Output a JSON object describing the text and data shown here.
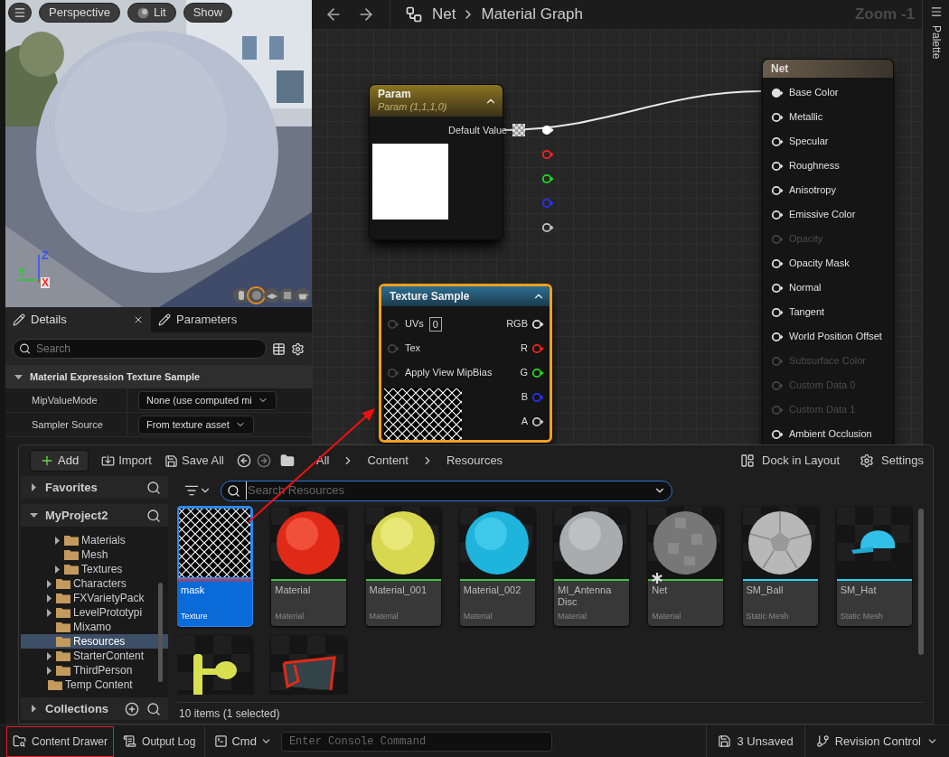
{
  "viewport": {
    "toolbar": [
      {
        "label": "Perspective",
        "icon": false
      },
      {
        "label": "Lit",
        "icon": true
      },
      {
        "label": "Show",
        "icon": false
      }
    ],
    "axes": [
      {
        "label": "Z",
        "color": "#3550ff"
      },
      {
        "label": "Y",
        "color": "#22d022"
      },
      {
        "label": "X",
        "color": "#ff2a2a"
      }
    ],
    "preview_shapes": [
      {
        "kind": "cylinder",
        "selected": false
      },
      {
        "kind": "sphere",
        "selected": true
      },
      {
        "kind": "plane",
        "selected": false
      },
      {
        "kind": "cube",
        "selected": false
      },
      {
        "kind": "teapot",
        "selected": false
      }
    ]
  },
  "details": {
    "tabs": [
      {
        "label": "Details",
        "selected": true,
        "closable": true
      },
      {
        "label": "Parameters",
        "selected": false,
        "closable": false
      }
    ],
    "search": {
      "placeholder": "Search"
    },
    "section": {
      "title": "Material Expression Texture Sample",
      "expanded": true
    },
    "properties": [
      {
        "name": "MipValueMode",
        "value": "None (use computed mi"
      },
      {
        "name": "Sampler Source",
        "value": "From texture asset"
      }
    ]
  },
  "graph": {
    "breadcrumb": [
      "Net",
      "Material Graph"
    ],
    "zoom": "Zoom -1",
    "palette": "Palette",
    "param_node": {
      "title": "Param",
      "subtitle": "Param (1,1,1,0)",
      "selected": false,
      "value_label": "Default Value",
      "outputs": [
        {
          "color": "#ffffff",
          "connected": true
        },
        {
          "color": "#ff2020",
          "connected": false
        },
        {
          "color": "#20e020",
          "connected": false
        },
        {
          "color": "#2a30ff",
          "connected": false
        },
        {
          "color": "#c8c8c8",
          "connected": false
        }
      ]
    },
    "texture_node": {
      "title": "Texture Sample",
      "selected": true,
      "inputs": [
        {
          "label": "UVs",
          "value": "0"
        },
        {
          "label": "Tex"
        },
        {
          "label": "Apply View MipBias"
        }
      ],
      "outputs": [
        {
          "label": "RGB",
          "color": "#e0e0e0"
        },
        {
          "label": "R",
          "color": "#ff2020"
        },
        {
          "label": "G",
          "color": "#20e020"
        },
        {
          "label": "B",
          "color": "#2a30ff"
        },
        {
          "label": "A",
          "color": "#c8c8c8"
        }
      ]
    },
    "output_node": {
      "title": "Net",
      "selected": false,
      "inputs": [
        {
          "label": "Base Color",
          "connected": true,
          "disabled": false
        },
        {
          "label": "Metallic",
          "connected": false,
          "disabled": false
        },
        {
          "label": "Specular",
          "connected": false,
          "disabled": false
        },
        {
          "label": "Roughness",
          "connected": false,
          "disabled": false
        },
        {
          "label": "Anisotropy",
          "connected": false,
          "disabled": false
        },
        {
          "label": "Emissive Color",
          "connected": false,
          "disabled": false
        },
        {
          "label": "Opacity",
          "connected": false,
          "disabled": true
        },
        {
          "label": "Opacity Mask",
          "connected": false,
          "disabled": false
        },
        {
          "label": "Normal",
          "connected": false,
          "disabled": false
        },
        {
          "label": "Tangent",
          "connected": false,
          "disabled": false
        },
        {
          "label": "World Position Offset",
          "connected": false,
          "disabled": false
        },
        {
          "label": "Subsurface Color",
          "connected": false,
          "disabled": true
        },
        {
          "label": "Custom Data 0",
          "connected": false,
          "disabled": true
        },
        {
          "label": "Custom Data 1",
          "connected": false,
          "disabled": true
        },
        {
          "label": "Ambient Occlusion",
          "connected": false,
          "disabled": false
        }
      ]
    }
  },
  "content_drawer": {
    "toolbar": {
      "add": "Add",
      "import": "Import",
      "save_all": "Save All",
      "path": [
        "All",
        "Content",
        "Resources"
      ],
      "dock": "Dock in Layout",
      "settings": "Settings"
    },
    "sidebar": {
      "favorites": {
        "label": "Favorites",
        "expanded": false
      },
      "project": {
        "label": "MyProject2",
        "expanded": true
      },
      "tree": [
        {
          "children": [
            {
              "children": [
                {
                  "label": "Materials",
                  "has_children": true,
                  "selected": false
                },
                {
                  "label": "Mesh",
                  "has_children": false,
                  "selected": false
                },
                {
                  "label": "Textures",
                  "has_children": true,
                  "selected": false
                }
              ]
            },
            {
              "label": "Characters",
              "has_children": true,
              "selected": false
            },
            {
              "label": "FXVarietyPack",
              "has_children": true,
              "selected": false
            },
            {
              "label": "LevelPrototypi",
              "has_children": true,
              "selected": false
            },
            {
              "label": "Mixamo",
              "has_children": false,
              "selected": false
            },
            {
              "label": "Resources",
              "has_children": false,
              "selected": true
            },
            {
              "label": "StarterContent",
              "has_children": true,
              "selected": false
            },
            {
              "label": "ThirdPerson",
              "has_children": true,
              "selected": false
            }
          ]
        },
        {
          "label": "Temp Content",
          "has_children": false,
          "selected": false
        }
      ],
      "collections": {
        "label": "Collections",
        "expanded": false
      }
    },
    "search": {
      "placeholder": "Search Resources"
    },
    "assets": [
      {
        "name": "mask",
        "type": "Texture",
        "color": "#e03030",
        "selected": true,
        "modified": false
      },
      {
        "name": "Material",
        "type": "Material",
        "color": "#40c040",
        "selected": false,
        "modified": false
      },
      {
        "name": "Material_001",
        "type": "Material",
        "color": "#40c040",
        "selected": false,
        "modified": false
      },
      {
        "name": "Material_002",
        "type": "Material",
        "color": "#40c040",
        "selected": false,
        "modified": false
      },
      {
        "name": "MI_Antenna Disc",
        "type": "Material",
        "color": "#40c040",
        "selected": false,
        "modified": false
      },
      {
        "name": "Net",
        "type": "Material",
        "color": "#40c040",
        "selected": false,
        "modified": true
      },
      {
        "name": "SM_Ball",
        "type": "Static Mesh",
        "color": "#20d8f0",
        "selected": false,
        "modified": false
      },
      {
        "name": "SM_Hat",
        "type": "Static Mesh",
        "color": "#20d8f0",
        "selected": false,
        "modified": false
      },
      {
        "selected": false
      },
      {
        "selected": false
      }
    ],
    "footer": "10 items (1 selected)"
  },
  "status_bar": {
    "tabs": [
      {
        "label": "Content Drawer",
        "selected": true
      },
      {
        "label": "Output Log",
        "selected": false
      }
    ],
    "cmd": "Cmd",
    "console": {
      "placeholder": "Enter Console Command"
    },
    "unsaved": "3 Unsaved",
    "revision": "Revision Control"
  }
}
